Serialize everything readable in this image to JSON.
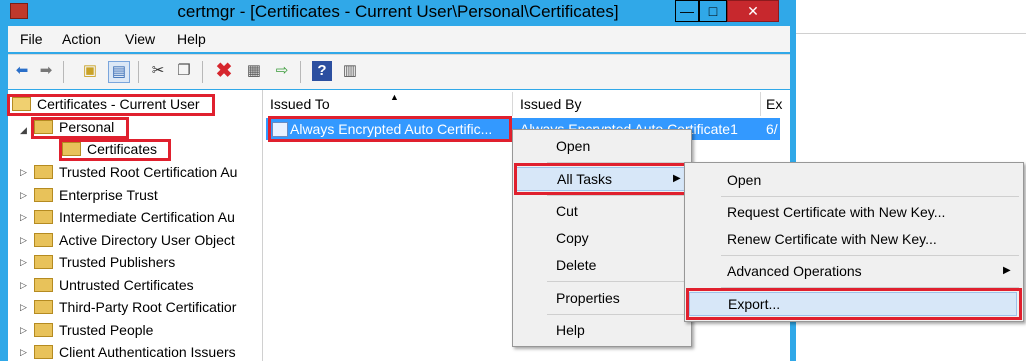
{
  "window": {
    "title": "certmgr - [Certificates - Current User\\Personal\\Certificates]",
    "minimize": "—",
    "maximize": "□",
    "close": "✕"
  },
  "menubar": {
    "items": [
      "File",
      "Action",
      "View",
      "Help"
    ]
  },
  "toolbar": {
    "icons": [
      "back-icon",
      "forward-icon",
      "up-folder-icon",
      "show-hide-tree-icon",
      "cut-icon",
      "copy-icon",
      "delete-icon",
      "properties-icon",
      "export-list-icon",
      "help-icon",
      "action-pane-icon"
    ]
  },
  "tree": {
    "root": "Certificates - Current User",
    "items": [
      {
        "label": "Personal"
      },
      {
        "label": "Certificates"
      },
      {
        "label": "Trusted Root Certification Au"
      },
      {
        "label": "Enterprise Trust"
      },
      {
        "label": "Intermediate Certification Au"
      },
      {
        "label": "Active Directory User Object"
      },
      {
        "label": "Trusted Publishers"
      },
      {
        "label": "Untrusted Certificates"
      },
      {
        "label": "Third-Party Root Certificatior"
      },
      {
        "label": "Trusted People"
      },
      {
        "label": "Client Authentication Issuers"
      }
    ]
  },
  "list": {
    "columns": [
      "Issued To",
      "Issued By",
      "Ex"
    ],
    "rows": [
      {
        "issued_to": "Always Encrypted Auto Certific...",
        "issued_by": "Always Encrypted Auto Certificate1",
        "expires": "6/"
      }
    ]
  },
  "context_menu": {
    "items": [
      "Open",
      "All Tasks",
      "Cut",
      "Copy",
      "Delete",
      "Properties",
      "Help"
    ]
  },
  "submenu": {
    "items": [
      "Open",
      "Request Certificate with New Key...",
      "Renew Certificate with New Key...",
      "Advanced Operations",
      "Export..."
    ]
  },
  "colors": {
    "titlebar": "#30a8e8",
    "selection": "#3399ff",
    "highlight_box": "#e0202e"
  }
}
